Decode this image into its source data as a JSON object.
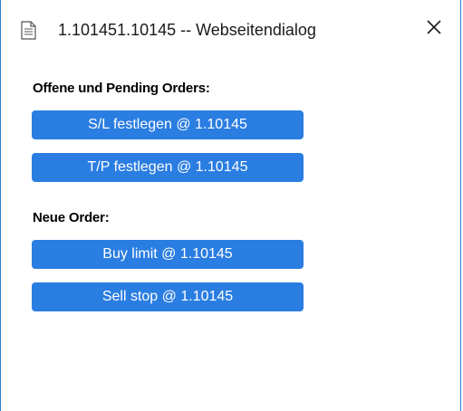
{
  "window": {
    "title": "1.101451.10145 -- Webseitendialog",
    "title_icon": "document-icon",
    "close_icon": "close-icon",
    "close_symbol": "✕"
  },
  "sections": {
    "open_orders": {
      "label": "Offene und Pending Orders:",
      "buttons": [
        {
          "label": "S/L festlegen @ 1.10145"
        },
        {
          "label": "T/P festlegen @ 1.10145"
        }
      ]
    },
    "new_order": {
      "label": "Neue Order:",
      "buttons": [
        {
          "label": "Buy limit @ 1.10145"
        },
        {
          "label": "Sell stop @ 1.10145"
        }
      ]
    }
  },
  "colors": {
    "button_bg": "#2a7de1",
    "button_text": "#ffffff",
    "window_border": "#2b7cd3"
  }
}
